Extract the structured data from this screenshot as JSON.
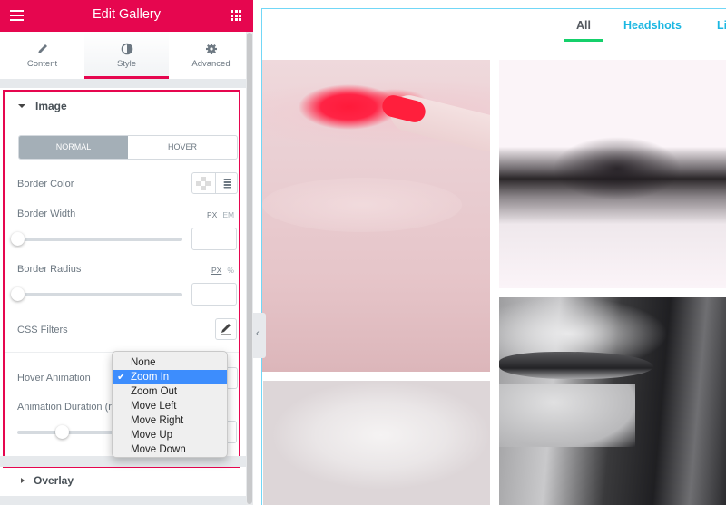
{
  "header": {
    "title": "Edit Gallery",
    "menu_icon": "hamburger-icon",
    "apps_icon": "grid-icon",
    "accent_color": "#e6064f"
  },
  "tabs": [
    {
      "label": "Content",
      "icon": "pencil-icon",
      "active": false
    },
    {
      "label": "Style",
      "icon": "half-circle-icon",
      "active": true
    },
    {
      "label": "Advanced",
      "icon": "gear-icon",
      "active": false
    }
  ],
  "image_section": {
    "title": "Image",
    "state_toggle": {
      "normal": "NORMAL",
      "hover": "HOVER",
      "active": "NORMAL"
    },
    "border_color": {
      "label": "Border Color"
    },
    "border_width": {
      "label": "Border Width",
      "units": [
        "PX",
        "EM"
      ],
      "active_unit": "PX",
      "value": "",
      "slider_fraction": 0
    },
    "border_radius": {
      "label": "Border Radius",
      "units": [
        "PX",
        "%"
      ],
      "active_unit": "PX",
      "value": "",
      "slider_fraction": 0
    },
    "css_filters": {
      "label": "CSS Filters"
    },
    "hover_animation": {
      "label": "Hover Animation",
      "selected": "Zoom In",
      "options": [
        "None",
        "Zoom In",
        "Zoom Out",
        "Move Left",
        "Move Right",
        "Move Up",
        "Move Down"
      ]
    },
    "animation_duration": {
      "label": "Animation Duration (ms)",
      "visible_label": "Animation Duration (r"
    }
  },
  "overlay_section": {
    "title": "Overlay"
  },
  "preview": {
    "filters": [
      {
        "label": "All",
        "active": true
      },
      {
        "label": "Headshots",
        "active": false
      },
      {
        "label": "Li",
        "active": false
      }
    ],
    "active_filter_color": "#15d06b",
    "link_color": "#1bb7e2",
    "collapse_icon": "chevron-left-icon"
  }
}
